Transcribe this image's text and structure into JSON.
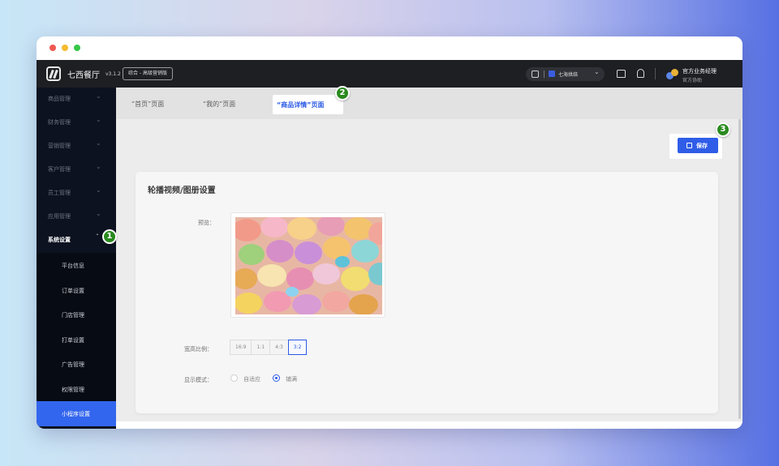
{
  "window": {
    "traffic_lights": [
      "close",
      "minimize",
      "maximize"
    ]
  },
  "topbar": {
    "logo_icon": "brand-logo-icon",
    "brand": "七西餐厅",
    "version": "v3.1.2",
    "edition": "综合 - 高级营销版",
    "store_selector": "七海烘焙",
    "user_name": "官方业务经理",
    "user_role": "官方协助"
  },
  "sidebar": {
    "items": [
      {
        "label": "商品管理"
      },
      {
        "label": "财务管理"
      },
      {
        "label": "营销管理"
      },
      {
        "label": "客户管理"
      },
      {
        "label": "员工管理"
      },
      {
        "label": "应用管理"
      }
    ],
    "active": {
      "label": "系统设置"
    },
    "sub_items": [
      {
        "label": "平台信息"
      },
      {
        "label": "订单设置"
      },
      {
        "label": "门店管理"
      },
      {
        "label": "打单设置"
      },
      {
        "label": "广告管理"
      },
      {
        "label": "权限管理"
      }
    ],
    "current": {
      "label": "小程序设置"
    }
  },
  "tabs": {
    "home": "“首页”页面",
    "mine": "“我的”页面",
    "detail": "“商品详情”页面"
  },
  "toolbar": {
    "save_label": "保存"
  },
  "card": {
    "title": "轮播视频/图册设置",
    "preview_label": "预览：",
    "ratio_label": "宽高比例：",
    "ratios": [
      "16:9",
      "1:1",
      "4:3",
      "3:2"
    ],
    "selected_ratio": "3:2",
    "mode_label": "显示模式：",
    "mode_options": [
      "自适应",
      "铺满"
    ],
    "selected_mode": "铺满"
  },
  "badges": [
    "1",
    "2",
    "3"
  ],
  "colors": {
    "accent": "#2f5de8",
    "sidebar_bg": "#0c1220",
    "badge": "#2a8a1e"
  }
}
